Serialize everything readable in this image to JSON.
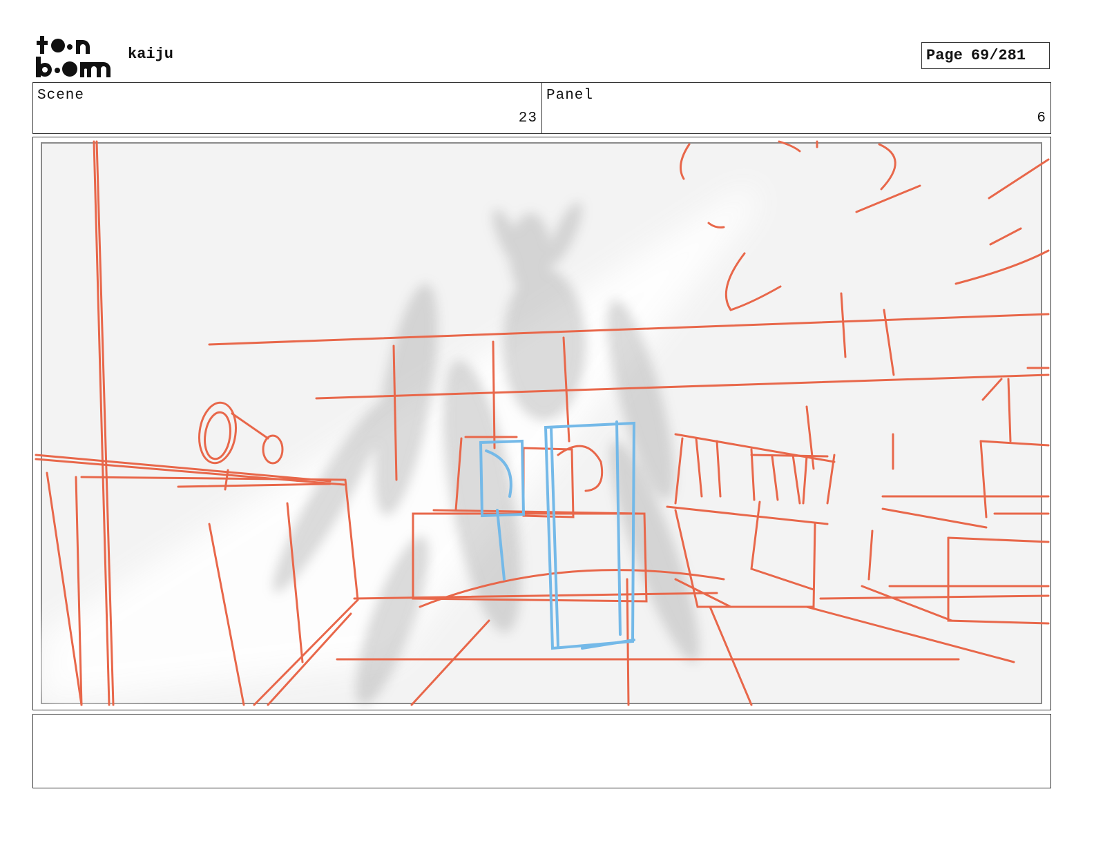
{
  "header": {
    "logo_text": "toon boom",
    "project_title": "kaiju",
    "page_label": "Page",
    "page_number": "69/281"
  },
  "info": {
    "scene_label": "Scene",
    "scene_value": "23",
    "panel_label": "Panel",
    "panel_value": "6"
  },
  "colors": {
    "sketch_red": "#e8674a",
    "sketch_blue": "#74b9e8",
    "shadow_gray": "#9a9a9a"
  },
  "notes": {
    "text": ""
  }
}
